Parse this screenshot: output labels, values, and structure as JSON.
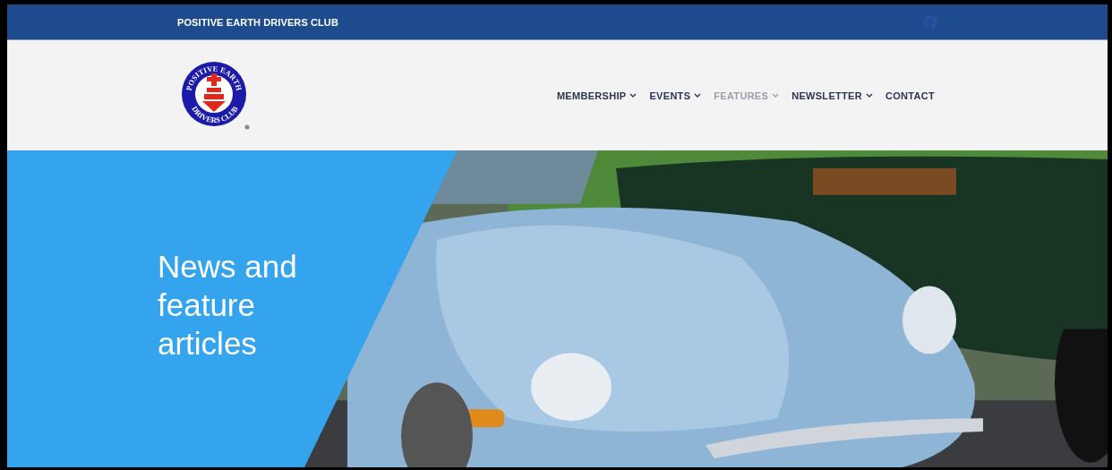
{
  "top_bar": {
    "site_name": "POSITIVE EARTH DRIVERS CLUB"
  },
  "logo": {
    "top_text": "POSITIVE EARTH",
    "bottom_text": "DRIVERS CLUB"
  },
  "nav": [
    {
      "label": "MEMBERSHIP",
      "dropdown": true,
      "selected": false
    },
    {
      "label": "EVENTS",
      "dropdown": true,
      "selected": false
    },
    {
      "label": "FEATURES",
      "dropdown": true,
      "selected": true
    },
    {
      "label": "NEWSLETTER",
      "dropdown": true,
      "selected": false
    },
    {
      "label": "CONTACT",
      "dropdown": false,
      "selected": false
    }
  ],
  "hero": {
    "heading": "News and feature articles"
  }
}
